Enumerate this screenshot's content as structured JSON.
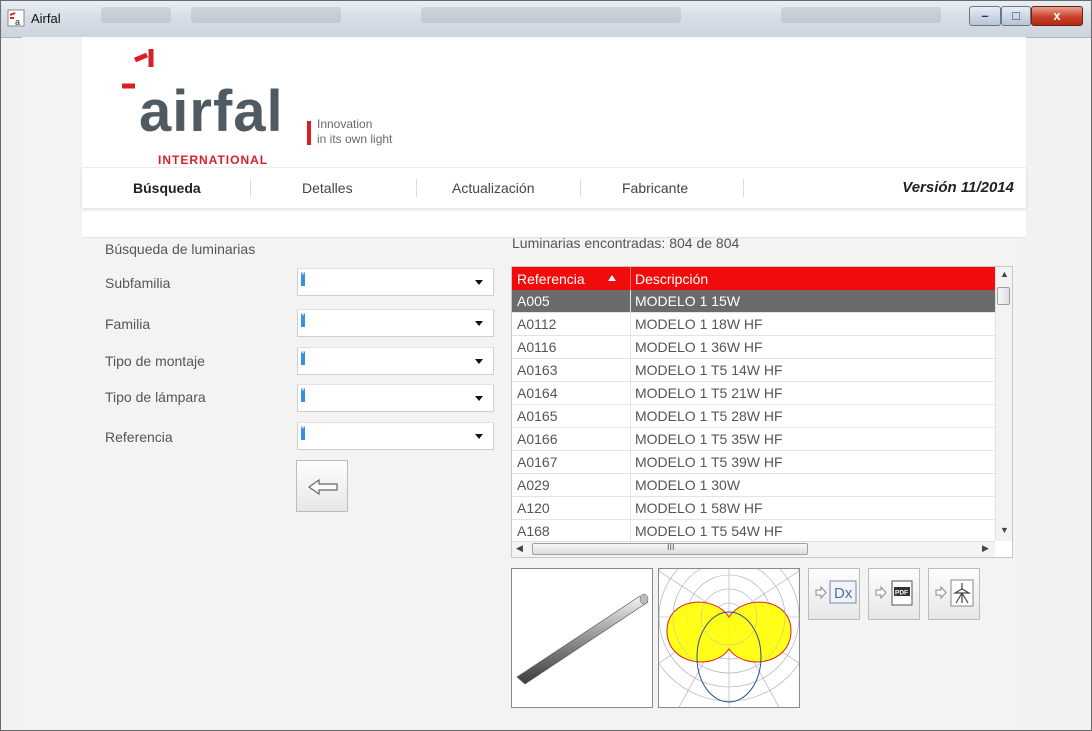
{
  "window": {
    "title": "Airfal"
  },
  "logo": {
    "brand": "airfal",
    "sub": "INTERNATIONAL",
    "slogan_line1": "Innovation",
    "slogan_line2": "in its own light"
  },
  "nav": {
    "items": [
      {
        "label": "Búsqueda",
        "active": true
      },
      {
        "label": "Detalles",
        "active": false
      },
      {
        "label": "Actualización",
        "active": false
      },
      {
        "label": "Fabricante",
        "active": false
      }
    ],
    "version": "Versión 11/2014"
  },
  "form": {
    "heading": "Búsqueda de luminarias",
    "fields": [
      {
        "label": "Subfamilia",
        "value": "*"
      },
      {
        "label": "Familia",
        "value": "*"
      },
      {
        "label": "Tipo de montaje",
        "value": "*"
      },
      {
        "label": "Tipo de lámpara",
        "value": "*"
      },
      {
        "label": "Referencia",
        "value": "*"
      }
    ]
  },
  "results": {
    "count_text": "Luminarias encontradas: 804 de 804",
    "columns": [
      "Referencia",
      "Descripción"
    ],
    "rows": [
      {
        "ref": "A005",
        "desc": "MODELO 1 15W",
        "selected": true
      },
      {
        "ref": "A0112",
        "desc": "MODELO 1 18W HF",
        "selected": false
      },
      {
        "ref": "A0116",
        "desc": "MODELO 1 36W HF",
        "selected": false
      },
      {
        "ref": "A0163",
        "desc": "MODELO 1 T5 14W HF",
        "selected": false
      },
      {
        "ref": "A0164",
        "desc": "MODELO 1 T5 21W HF",
        "selected": false
      },
      {
        "ref": "A0165",
        "desc": "MODELO 1 T5 28W HF",
        "selected": false
      },
      {
        "ref": "A0166",
        "desc": "MODELO 1 T5 35W HF",
        "selected": false
      },
      {
        "ref": "A0167",
        "desc": "MODELO 1 T5 39W HF",
        "selected": false
      },
      {
        "ref": "A029",
        "desc": "MODELO 1 30W",
        "selected": false
      },
      {
        "ref": "A120",
        "desc": "MODELO 1 58W HF",
        "selected": false
      },
      {
        "ref": "A168",
        "desc": "MODELO 1 T5 54W HF",
        "selected": false
      }
    ],
    "scroll_grip": "III"
  },
  "actions": {
    "dialux_label": "Dx",
    "pdf_label": "PDF"
  },
  "colors": {
    "accent": "#f10c0c",
    "brand_red": "#d81f27",
    "selected_row": "#6b6b6b",
    "photometric_fill": "#ffff00"
  }
}
